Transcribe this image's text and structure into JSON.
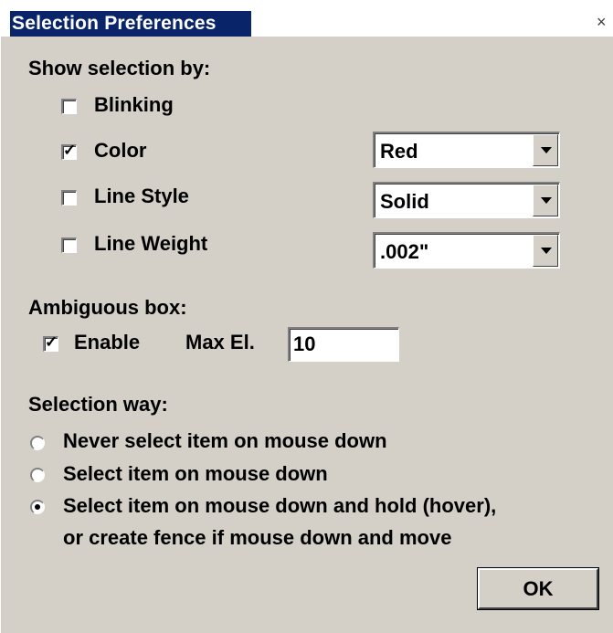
{
  "window": {
    "title": "Selection Preferences",
    "close_glyph": "×"
  },
  "show_selection": {
    "heading": "Show selection by:",
    "options": [
      {
        "label": "Blinking",
        "checked": false
      },
      {
        "label": "Color",
        "checked": true,
        "dropdown": "Red"
      },
      {
        "label": "Line Style",
        "checked": false,
        "dropdown": "Solid"
      },
      {
        "label": "Line Weight",
        "checked": false,
        "dropdown": ".002\""
      }
    ]
  },
  "ambiguous": {
    "heading": "Ambiguous box:",
    "enable_label": "Enable",
    "enable_checked": true,
    "max_label": "Max El.",
    "max_value": "10"
  },
  "selection_way": {
    "heading": "Selection way:",
    "options": [
      {
        "label": "Never select item on mouse down",
        "selected": false
      },
      {
        "label": "Select item on mouse down",
        "selected": false
      },
      {
        "label": "Select item on mouse down and hold (hover),",
        "label2": "or create fence if mouse down and move",
        "selected": true
      }
    ]
  },
  "ok_label": "OK",
  "check_glyph": "✓",
  "colors": {
    "title_bar": "#0a246a",
    "dialog_bg": "#d4d0c8"
  }
}
